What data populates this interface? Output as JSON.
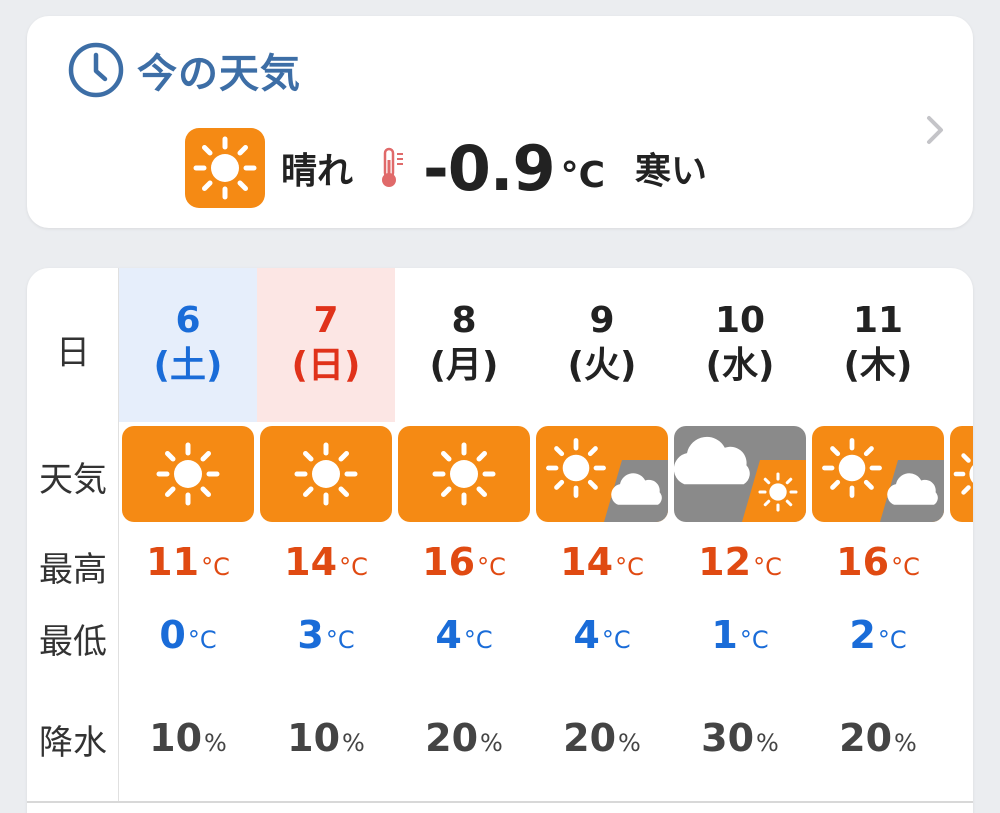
{
  "current": {
    "title": "今の天気",
    "condition": "晴れ",
    "temperature": "-0.9",
    "unit": "°C",
    "feeling": "寒い",
    "icon": "sunny-icon"
  },
  "colors": {
    "sunny_bg": "#f58a14",
    "cloudy_bg": "#8a8a8a",
    "saturday": "#1a6cd8",
    "sunday": "#e0321a",
    "high": "#e04a12",
    "low": "#1a6cd8",
    "title": "#3d6ea6"
  },
  "forecast": {
    "row_labels": {
      "date": "日",
      "weather": "天気",
      "high": "最高",
      "low": "最低",
      "precip": "降水"
    },
    "temp_unit": "°C",
    "precip_unit": "%",
    "days": [
      {
        "day": "6",
        "weekday": "(土)",
        "type": "sat",
        "weather": "sunny",
        "high": "11",
        "low": "0",
        "precip": "10"
      },
      {
        "day": "7",
        "weekday": "(日)",
        "type": "sun",
        "weather": "sunny",
        "high": "14",
        "low": "3",
        "precip": "10"
      },
      {
        "day": "8",
        "weekday": "(月)",
        "type": "norm",
        "weather": "sunny",
        "high": "16",
        "low": "4",
        "precip": "20"
      },
      {
        "day": "9",
        "weekday": "(火)",
        "type": "norm",
        "weather": "sunny-then-cloudy",
        "high": "14",
        "low": "4",
        "precip": "20"
      },
      {
        "day": "10",
        "weekday": "(水)",
        "type": "norm",
        "weather": "cloudy-then-sunny",
        "high": "12",
        "low": "1",
        "precip": "30"
      },
      {
        "day": "11",
        "weekday": "(木)",
        "type": "norm",
        "weather": "sunny-then-cloudy",
        "high": "16",
        "low": "2",
        "precip": "20"
      }
    ]
  }
}
